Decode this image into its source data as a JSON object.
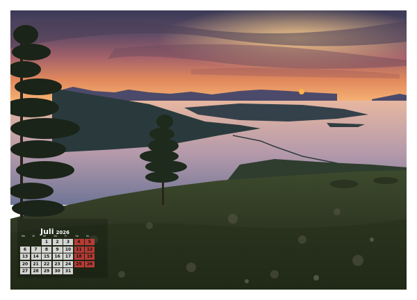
{
  "calendar": {
    "month": "Juli",
    "year": "2026",
    "weekdays": [
      "Mo",
      "Di",
      "Mi",
      "Do",
      "Fr",
      "Sa",
      "So"
    ],
    "days": [
      "1",
      "2",
      "3",
      "4",
      "5",
      "6",
      "7",
      "8",
      "9",
      "10",
      "11",
      "12",
      "13",
      "14",
      "15",
      "16",
      "17",
      "18",
      "19",
      "20",
      "21",
      "22",
      "23",
      "24",
      "25",
      "26",
      "27",
      "28",
      "29",
      "30",
      "31"
    ],
    "first_weekday_index": 2,
    "weekend_color": "#cd3e3a",
    "weekday_cell_color": "#e4e4e4"
  },
  "photo": {
    "subject": "sunset over fjord with islands, pine trees and heath in foreground",
    "sky_colors": [
      "#3c3a55",
      "#8a5a6e",
      "#e0805a",
      "#f4b06a"
    ],
    "sun_color": "#ff9a3c"
  }
}
